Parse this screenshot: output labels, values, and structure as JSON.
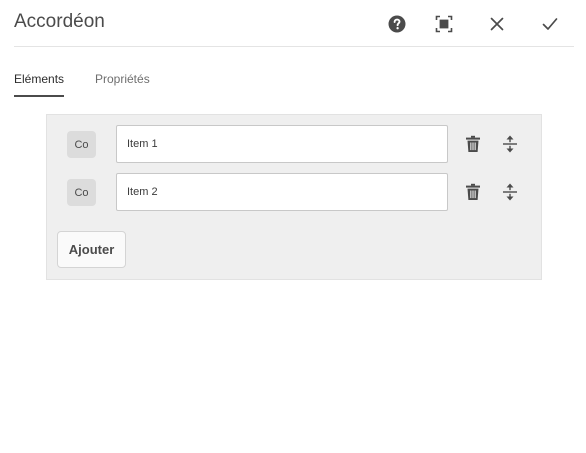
{
  "dialog": {
    "title": "Accordéon"
  },
  "header_icons": {
    "help": "help-icon",
    "fullscreen": "fullscreen-icon",
    "close": "close-icon",
    "done": "checkmark-icon"
  },
  "tabs": [
    {
      "label": "Eléments",
      "active": true
    },
    {
      "label": "Propriétés",
      "active": false
    }
  ],
  "items": [
    {
      "handle_label": "Co",
      "value": "Item 1"
    },
    {
      "handle_label": "Co",
      "value": "Item 2"
    }
  ],
  "item_icons": {
    "delete": "trash-icon",
    "reorder": "reorder-icon"
  },
  "add_button": {
    "label": "Ajouter"
  },
  "colors": {
    "text": "#4b4b4b",
    "panel_bg": "#efefef",
    "icon": "#4b4b4b"
  }
}
